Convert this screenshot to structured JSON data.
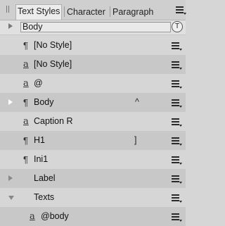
{
  "tabs": [
    {
      "label": "Text Styles",
      "active": true
    },
    {
      "label": "Character",
      "active": false
    },
    {
      "label": "Paragraph",
      "active": false
    }
  ],
  "header": {
    "style_name": "Body",
    "icon": "T"
  },
  "rows": [
    {
      "icon": "paragraph-icon",
      "glyph": "¶",
      "label": "[No Style]",
      "shade": "#d6d6d6"
    },
    {
      "icon": "character-style-icon",
      "glyph": "a",
      "label": "[No Style]",
      "shade": "#c8c8c8"
    },
    {
      "icon": "character-style-icon",
      "glyph": "a",
      "label": "@",
      "shade": "#d6d6d6"
    },
    {
      "icon": "paragraph-icon",
      "glyph": "¶",
      "label": "Body",
      "shade": "#c8c8c8",
      "expand": "right",
      "marker": "^"
    },
    {
      "icon": "character-style-icon",
      "glyph": "a",
      "label": "Caption R",
      "shade": "#d6d6d6"
    },
    {
      "icon": "paragraph-icon",
      "glyph": "¶",
      "label": "H1",
      "shade": "#c8c8c8",
      "marker": "]"
    },
    {
      "icon": "paragraph-icon",
      "glyph": "¶",
      "label": "Ini1",
      "shade": "#d6d6d6"
    },
    {
      "icon": "",
      "glyph": "",
      "label": "Label",
      "shade": "#c8c8c8",
      "expand": "right"
    },
    {
      "icon": "",
      "glyph": "",
      "label": "Texts",
      "shade": "#d6d6d6",
      "expand": "down"
    },
    {
      "icon": "character-style-icon",
      "glyph": "a",
      "label": "@body",
      "shade": "#c8c8c8",
      "indent": true
    }
  ]
}
